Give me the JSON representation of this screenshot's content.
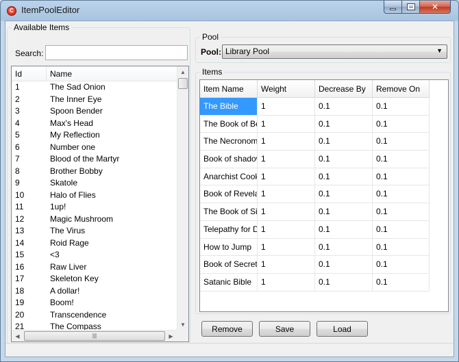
{
  "window": {
    "title": "ItemPoolEditor",
    "icon": "app-logo-icon"
  },
  "available": {
    "title": "Available Items",
    "search_label": "Search:",
    "search_value": "",
    "columns": [
      "Id",
      "Name"
    ],
    "items": [
      {
        "id": "1",
        "name": "The Sad Onion"
      },
      {
        "id": "2",
        "name": "The Inner Eye"
      },
      {
        "id": "3",
        "name": "Spoon Bender"
      },
      {
        "id": "4",
        "name": "Max's Head"
      },
      {
        "id": "5",
        "name": "My Reflection"
      },
      {
        "id": "6",
        "name": "Number one"
      },
      {
        "id": "7",
        "name": "Blood of the Martyr"
      },
      {
        "id": "8",
        "name": "Brother Bobby"
      },
      {
        "id": "9",
        "name": "Skatole"
      },
      {
        "id": "10",
        "name": "Halo of Flies"
      },
      {
        "id": "11",
        "name": "1up!"
      },
      {
        "id": "12",
        "name": "Magic Mushroom"
      },
      {
        "id": "13",
        "name": "The Virus"
      },
      {
        "id": "14",
        "name": "Roid Rage"
      },
      {
        "id": "15",
        "name": "<3"
      },
      {
        "id": "16",
        "name": "Raw Liver"
      },
      {
        "id": "17",
        "name": "Skeleton Key"
      },
      {
        "id": "18",
        "name": "A dollar!"
      },
      {
        "id": "19",
        "name": "Boom!"
      },
      {
        "id": "20",
        "name": "Transcendence"
      },
      {
        "id": "21",
        "name": "The Compass"
      }
    ]
  },
  "pool": {
    "group_title": "Pool",
    "label": "Pool:",
    "selected": "Library Pool"
  },
  "items": {
    "group_title": "Items",
    "columns": [
      "Item Name",
      "Weight",
      "Decrease By",
      "Remove On"
    ],
    "rows": [
      {
        "name": "The Bible",
        "weight": "1",
        "decrease": "0.1",
        "remove": "0.1",
        "selected": true
      },
      {
        "name": "The Book of Belial",
        "weight": "1",
        "decrease": "0.1",
        "remove": "0.1"
      },
      {
        "name": "The Necronomicon",
        "weight": "1",
        "decrease": "0.1",
        "remove": "0.1"
      },
      {
        "name": "Book of shadows",
        "weight": "1",
        "decrease": "0.1",
        "remove": "0.1"
      },
      {
        "name": "Anarchist Cookbook",
        "weight": "1",
        "decrease": "0.1",
        "remove": "0.1"
      },
      {
        "name": "Book of Revelations",
        "weight": "1",
        "decrease": "0.1",
        "remove": "0.1"
      },
      {
        "name": "The Book of Sin",
        "weight": "1",
        "decrease": "0.1",
        "remove": "0.1"
      },
      {
        "name": "Telepathy for Dummies",
        "weight": "1",
        "decrease": "0.1",
        "remove": "0.1"
      },
      {
        "name": "How to Jump",
        "weight": "1",
        "decrease": "0.1",
        "remove": "0.1"
      },
      {
        "name": "Book of Secrets",
        "weight": "1",
        "decrease": "0.1",
        "remove": "0.1"
      },
      {
        "name": "Satanic Bible",
        "weight": "1",
        "decrease": "0.1",
        "remove": "0.1"
      }
    ]
  },
  "buttons": {
    "remove": "Remove",
    "save": "Save",
    "load": "Load"
  },
  "colors": {
    "selection": "#3399ff"
  }
}
